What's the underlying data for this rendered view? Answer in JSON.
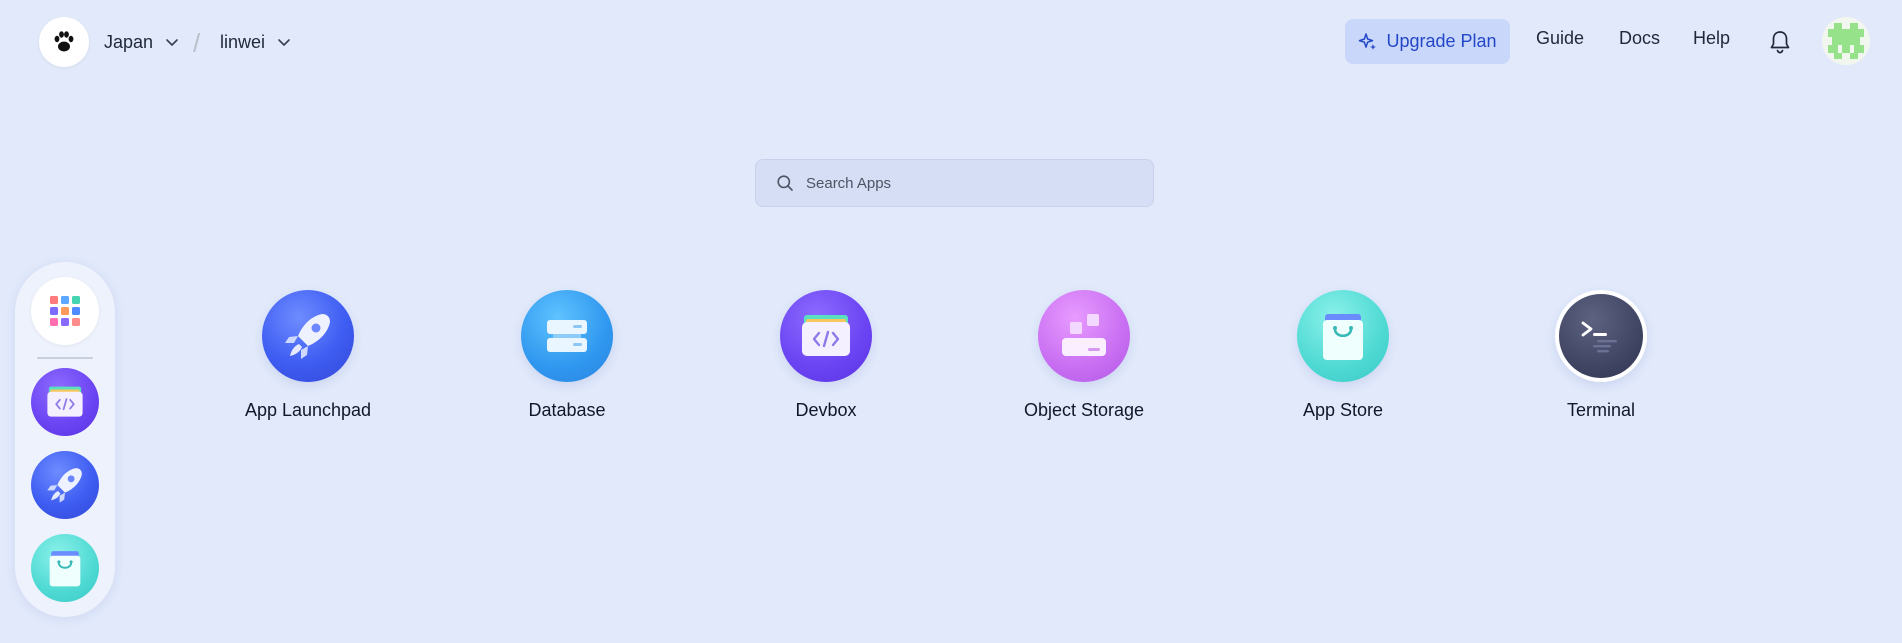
{
  "header": {
    "region": "Japan",
    "workspace": "linwei",
    "upgrade_label": "Upgrade Plan",
    "nav": {
      "guide": "Guide",
      "docs": "Docs",
      "help": "Help"
    }
  },
  "search": {
    "placeholder": "Search Apps"
  },
  "apps": [
    {
      "label": "App Launchpad",
      "icon": "rocket-icon"
    },
    {
      "label": "Database",
      "icon": "database-icon"
    },
    {
      "label": "Devbox",
      "icon": "devbox-icon"
    },
    {
      "label": "Object Storage",
      "icon": "object-storage-icon"
    },
    {
      "label": "App Store",
      "icon": "shopping-bag-icon"
    },
    {
      "label": "Terminal",
      "icon": "terminal-icon"
    }
  ],
  "dock": [
    {
      "icon": "app-grid-icon"
    },
    {
      "icon": "devbox-icon"
    },
    {
      "icon": "rocket-icon"
    },
    {
      "icon": "shopping-bag-icon"
    }
  ],
  "colors": {
    "background": "#e1e9fb",
    "accent": "#2447c7",
    "upgrade_bg": "#c9d7fb"
  }
}
